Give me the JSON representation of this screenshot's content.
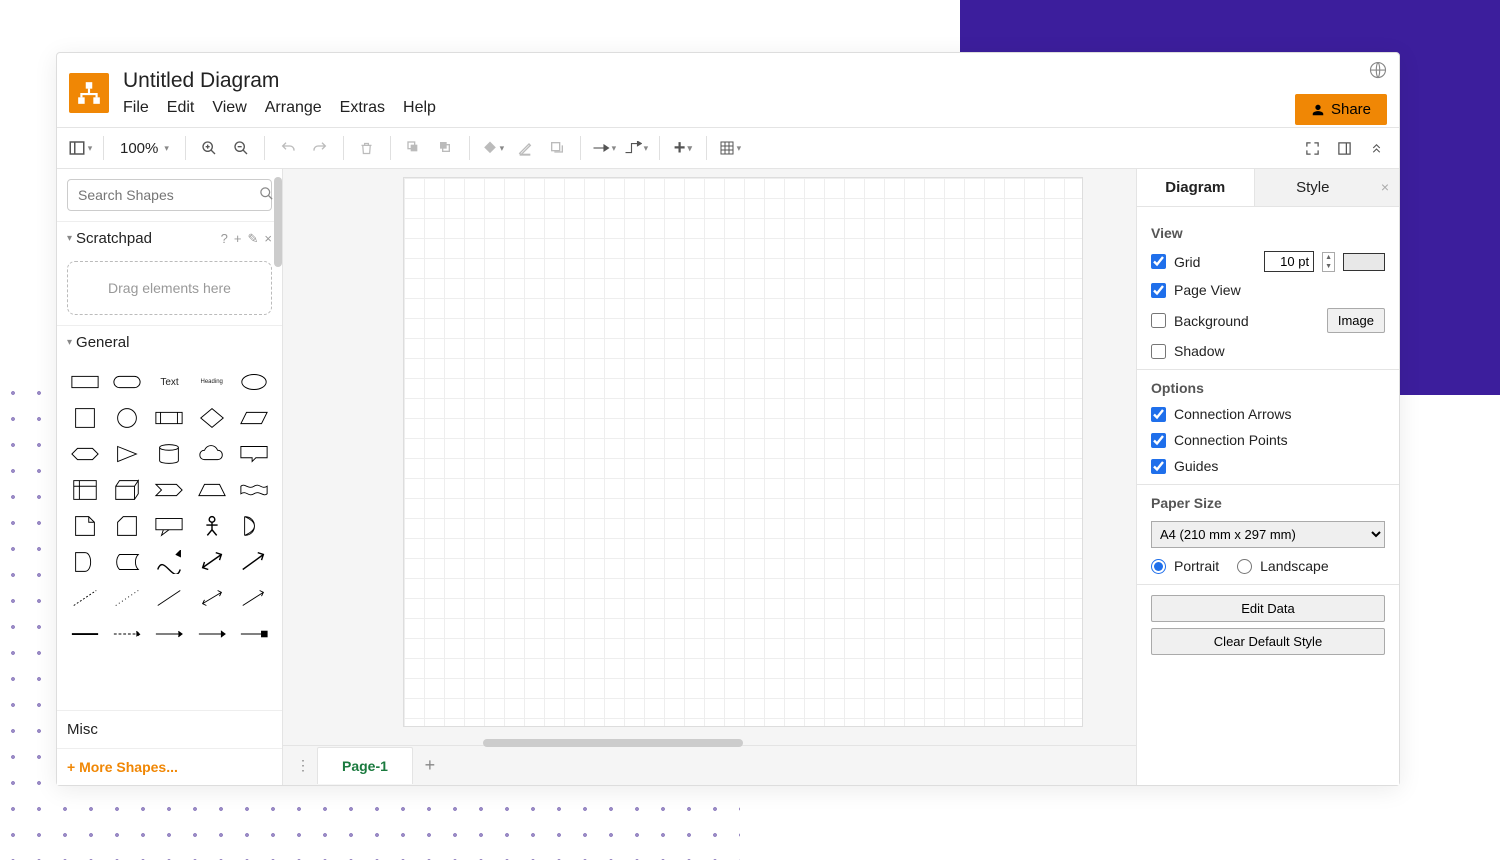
{
  "doc_title": "Untitled Diagram",
  "menus": [
    "File",
    "Edit",
    "View",
    "Arrange",
    "Extras",
    "Help"
  ],
  "share_label": "Share",
  "zoom_label": "100%",
  "left": {
    "search_placeholder": "Search Shapes",
    "scratchpad_label": "Scratchpad",
    "scratchpad_hint": "Drag elements here",
    "general_label": "General",
    "shape_text_label": "Text",
    "shape_heading_label": "Heading",
    "misc_label": "Misc",
    "more_shapes_label": "+ More Shapes..."
  },
  "pages": {
    "tab1": "Page-1"
  },
  "right": {
    "tab_diagram": "Diagram",
    "tab_style": "Style",
    "view_label": "View",
    "grid_label": "Grid",
    "grid_value": "10 pt",
    "pageview_label": "Page View",
    "background_label": "Background",
    "image_btn": "Image",
    "shadow_label": "Shadow",
    "options_label": "Options",
    "conn_arrows_label": "Connection Arrows",
    "conn_points_label": "Connection Points",
    "guides_label": "Guides",
    "paper_label": "Paper Size",
    "paper_value": "A4 (210 mm x 297 mm)",
    "portrait_label": "Portrait",
    "landscape_label": "Landscape",
    "edit_data_btn": "Edit Data",
    "clear_style_btn": "Clear Default Style",
    "checked": {
      "grid": true,
      "pageview": true,
      "background": false,
      "shadow": false,
      "conn_arrows": true,
      "conn_points": true,
      "guides": true,
      "portrait": true,
      "landscape": false
    }
  }
}
